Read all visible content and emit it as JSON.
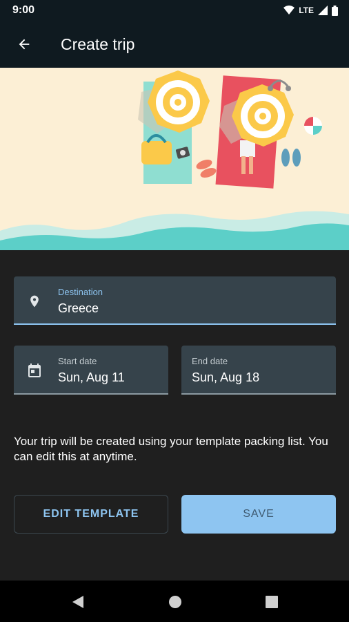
{
  "status_bar": {
    "time": "9:00",
    "network": "LTE"
  },
  "app_bar": {
    "title": "Create trip",
    "back_icon": "arrow-back-icon"
  },
  "destination": {
    "label": "Destination",
    "value": "Greece",
    "icon": "location-pin-icon"
  },
  "start_date": {
    "label": "Start date",
    "value": "Sun, Aug 11",
    "icon": "calendar-icon"
  },
  "end_date": {
    "label": "End date",
    "value": "Sun, Aug 18"
  },
  "info_text": "Your trip will be created using your template packing list. You can edit this at anytime.",
  "buttons": {
    "edit_template": "EDIT TEMPLATE",
    "save": "SAVE"
  },
  "colors": {
    "accent": "#8ec5f1",
    "surface": "#36434b",
    "background": "#1f1f1f",
    "sand": "#fcefd5",
    "sea": "#5ccfc8"
  }
}
